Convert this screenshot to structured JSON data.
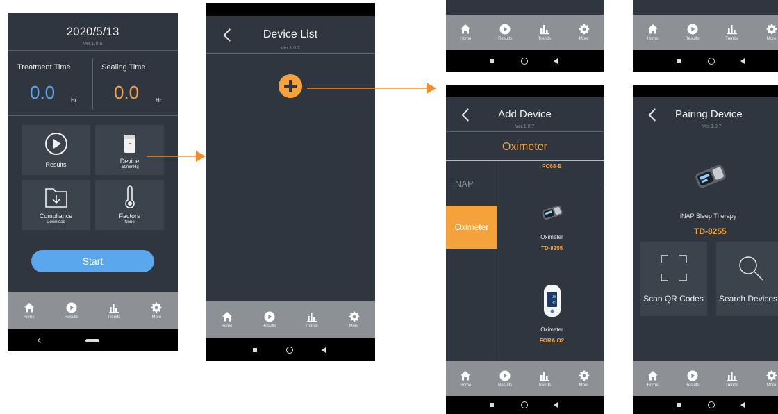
{
  "colors": {
    "screen_bg": "#2f363f",
    "tile_bg": "#3b434c",
    "tab_bg": "#8d9196",
    "accent_orange": "#f4a33c",
    "accent_blue": "#5aa7ee",
    "start_button": "#5aa7ee"
  },
  "tabs": [
    {
      "label": "Home",
      "icon": "home-icon"
    },
    {
      "label": "Results",
      "icon": "play-circle-icon"
    },
    {
      "label": "Trends",
      "icon": "bar-chart-icon"
    },
    {
      "label": "More",
      "icon": "gear-icon"
    }
  ],
  "home": {
    "date": "2020/5/13",
    "version": "Ver.1.0.8",
    "treatment_label": "Treatment Time",
    "treatment_value": "0.0",
    "treatment_unit": "Hr",
    "sealing_label": "Sealing Time",
    "sealing_value": "0.0",
    "sealing_unit": "Hr",
    "tiles": [
      {
        "label": "Results",
        "sub": ""
      },
      {
        "label": "Device",
        "sub": "-59mmHg"
      },
      {
        "label": "Compliance",
        "sub": "Download"
      },
      {
        "label": "Factors",
        "sub": "None"
      }
    ],
    "start_label": "Start"
  },
  "device_list": {
    "title": "Device List",
    "version": "Ver.1.0.7"
  },
  "add_device": {
    "title": "Add Device",
    "version": "Ver.1.0.7",
    "category": "Oximeter",
    "side_items": [
      "iNAP",
      "Oximeter"
    ],
    "devices": [
      {
        "name": "",
        "model": "PC68-B"
      },
      {
        "name": "Oximeter",
        "model": "TD-8255"
      },
      {
        "name": "Oximeter",
        "model": "FORA O2"
      }
    ],
    "fora_reading_top": "98",
    "fora_reading_bottom": "80"
  },
  "pairing": {
    "title": "Pairing Device",
    "version": "Ver.1.0.7",
    "device_name": "iNAP Sleep Therapy",
    "model": "TD-8255",
    "scan_label": "Scan QR Codes",
    "search_label": "Search Devices"
  }
}
